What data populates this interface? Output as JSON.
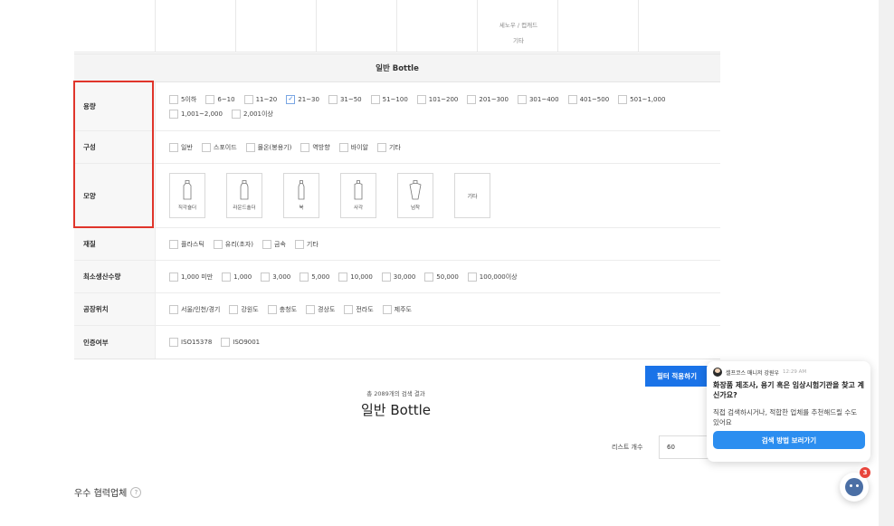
{
  "top_table": {
    "cell_line1": "세노우 / 컵캐드",
    "cell_line2": "기타"
  },
  "section_title": "일반 Bottle",
  "filters": {
    "capacity": {
      "label": "용량",
      "options": [
        "5이하",
        "6~10",
        "11~20",
        "21~30",
        "31~50",
        "51~100",
        "101~200",
        "201~300",
        "301~400",
        "401~500",
        "501~1,000",
        "1,001~2,000",
        "2,001이상"
      ],
      "checked": "21~30"
    },
    "composition": {
      "label": "구성",
      "options": [
        "일반",
        "스포이드",
        "몰온(봉용기)",
        "역방향",
        "바이알",
        "기타"
      ]
    },
    "shape": {
      "label": "모양",
      "options": [
        "직각숄더",
        "라운드숄더",
        "북",
        "사각",
        "넘착",
        "기타"
      ]
    },
    "material": {
      "label": "재질",
      "options": [
        "플라스틱",
        "유리(초자)",
        "금속",
        "기타"
      ]
    },
    "moq": {
      "label": "최소생산수량",
      "options": [
        "1,000 미만",
        "1,000",
        "3,000",
        "5,000",
        "10,000",
        "30,000",
        "50,000",
        "100,000이상"
      ]
    },
    "factory": {
      "label": "공장위치",
      "options": [
        "서울/인천/경기",
        "강원도",
        "충청도",
        "경상도",
        "전라도",
        "제주도"
      ]
    },
    "cert": {
      "label": "인증여부",
      "options": [
        "ISO15378",
        "ISO9001"
      ]
    }
  },
  "apply_button": "필터 적용하기",
  "result": {
    "count_text": "총 2089개의 검색 결과",
    "title": "일반 Bottle"
  },
  "list_count": {
    "label": "리스트 개수",
    "value": "60"
  },
  "partners": {
    "title": "우수 협력업체",
    "help": "?"
  },
  "chat": {
    "sender": "셀프코스 매니저 강원우",
    "time": "12:29 AM",
    "message1": "화장품 제조사, 용기 혹은 임상시험기관을 찾고 계신가요?",
    "message2": "직접 검색하시거나, 적합한 업체를 추천해드릴 수도 있어요",
    "button": "검색 방법 보러가기",
    "badge": "3"
  }
}
